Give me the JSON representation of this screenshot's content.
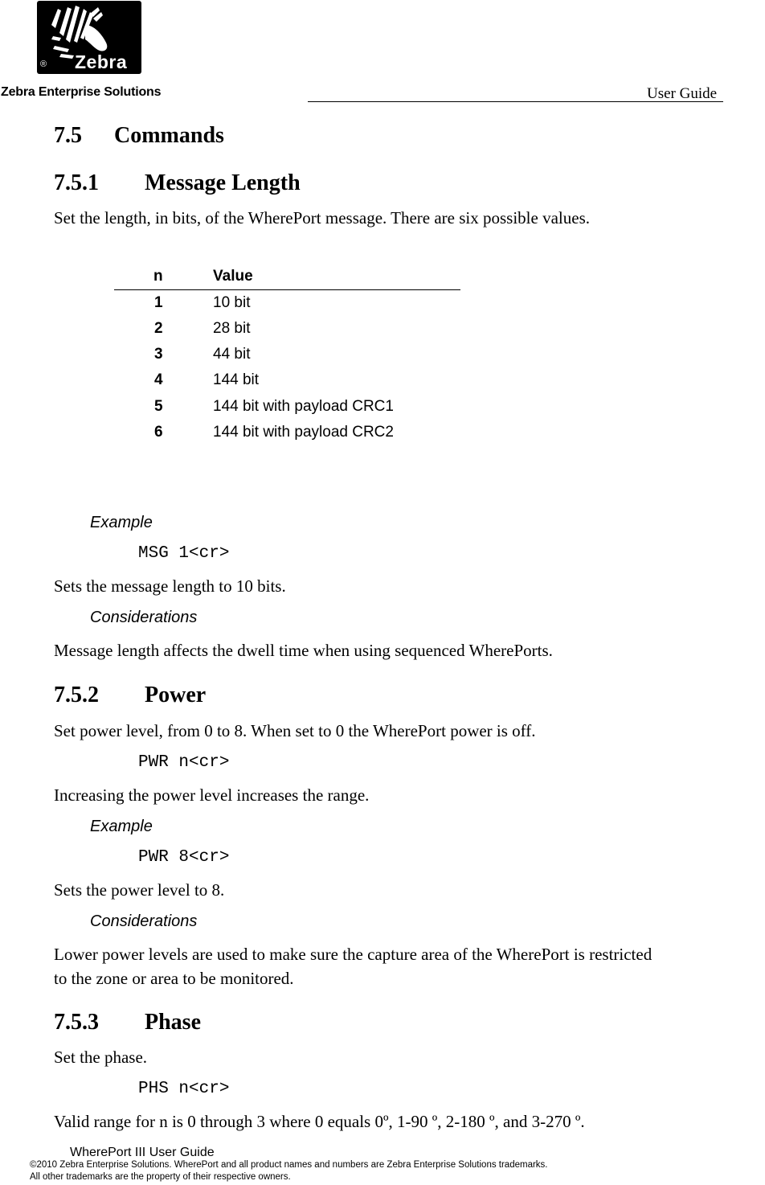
{
  "header": {
    "logo": {
      "icon": "zebra-head-logo-icon",
      "wordmark": "Zebra",
      "registered": "®"
    },
    "company": "Zebra Enterprise Solutions",
    "doc_type": "User Guide"
  },
  "section": {
    "number": "7.5",
    "title": "Commands"
  },
  "subsections": [
    {
      "number": "7.5.1",
      "title": "Message Length",
      "intro": "Set the length, in bits, of the WherePort message. There are six possible values.",
      "table": {
        "headers": [
          "n",
          "Value"
        ],
        "rows": [
          {
            "n": "1",
            "value": "10 bit"
          },
          {
            "n": "2",
            "value": "28 bit"
          },
          {
            "n": "3",
            "value": "44 bit"
          },
          {
            "n": "4",
            "value": "144 bit"
          },
          {
            "n": "5",
            "value": "144 bit with payload CRC1"
          },
          {
            "n": "6",
            "value": "144 bit with payload CRC2"
          }
        ]
      },
      "example_label": "Example",
      "example_cmd": "MSG 1<cr>",
      "example_desc": "Sets the message length to 10 bits.",
      "considerations_label": "Considerations",
      "considerations_text": "Message length affects the dwell time when using sequenced WherePorts."
    },
    {
      "number": "7.5.2",
      "title": "Power",
      "intro": "Set power level, from 0 to 8. When set to 0 the WherePort power is off.",
      "syntax_cmd": "PWR n<cr>",
      "note": "Increasing the power level increases the range.",
      "example_label": "Example",
      "example_cmd": "PWR 8<cr>",
      "example_desc": "Sets the power level to 8.",
      "considerations_label": "Considerations",
      "considerations_line1": "Lower power levels are used to make sure the capture area of the WherePort is restricted",
      "considerations_line2": "to the zone or area to be monitored."
    },
    {
      "number": "7.5.3",
      "title": "Phase",
      "intro": "Set the phase.",
      "syntax_cmd": "PHS n<cr>",
      "range_text": "Valid range for n is 0 through 3 where 0 equals 0º, 1-90 º, 2-180 º, and 3-270 º."
    }
  ],
  "footer": {
    "title": "WherePort III User Guide",
    "copyright": "©2010 Zebra Enterprise Solutions.  WherePort and all product names and numbers are Zebra Enterprise Solutions trademarks.",
    "trademarks": "All other trademarks are the property of their respective owners."
  }
}
